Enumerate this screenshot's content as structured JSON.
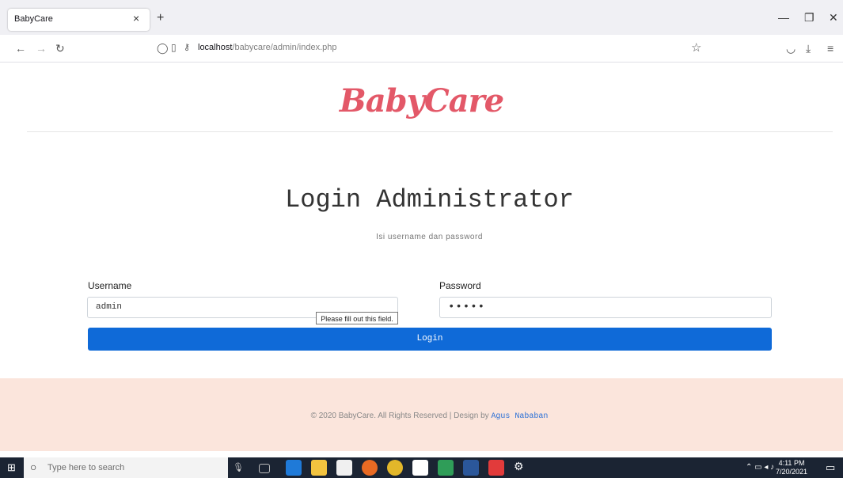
{
  "browser": {
    "tab_title": "BabyCare",
    "url_host": "localhost",
    "url_path": "/babycare/admin/index.php"
  },
  "page": {
    "logo": "BabyCare",
    "title": "Login Administrator",
    "subtitle": "Isi username dan password",
    "username_label": "Username",
    "username_value": "admin",
    "password_label": "Password",
    "password_value": "•••••",
    "tooltip": "Please fill out this field.",
    "login_button": "Login",
    "footer_text": "© 2020 BabyCare. All Rights Reserved | Design by ",
    "footer_author": "Agus Nababan"
  },
  "taskbar": {
    "search_placeholder": "Type here to search",
    "time": "4:11 PM",
    "date": "7/20/2021"
  }
}
